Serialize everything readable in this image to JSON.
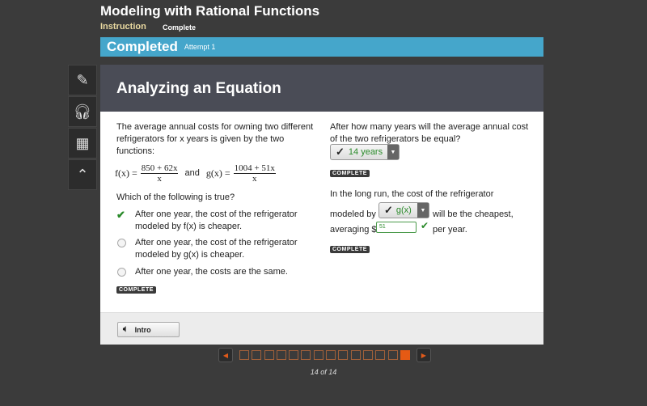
{
  "header": {
    "title": "Modeling with Rational Functions",
    "tabs": [
      "Instruction",
      "Complete"
    ]
  },
  "status": {
    "label": "Completed",
    "attempt": "Attempt 1",
    "color": "#45a6cb"
  },
  "tools": [
    "pencil-icon",
    "headphones-icon",
    "calculator-icon",
    "up-caret-icon"
  ],
  "section_title": "Analyzing an Equation",
  "left": {
    "intro": "The average annual costs for owning two different refrigerators for x years is given by the two functions:",
    "f_lhs": "f(x) =",
    "f_num": "850 + 62x",
    "f_den": "x",
    "and": "and",
    "g_lhs": "g(x) =",
    "g_num": "1004 + 51x",
    "g_den": "x",
    "question": "Which of the following is true?",
    "options": [
      {
        "text": "After one year, the cost of the refrigerator modeled by f(x) is cheaper.",
        "selected": true
      },
      {
        "text": "After one year, the cost of the refrigerator modeled by g(x) is cheaper.",
        "selected": false
      },
      {
        "text": "After one year, the costs are the same.",
        "selected": false
      }
    ],
    "badge": "COMPLETE"
  },
  "right": {
    "q1": "After how many years will the average annual cost of the two refrigerators be equal?",
    "q1_answer": "14 years",
    "badge": "COMPLETE",
    "q2_a": "In the long run, the cost of the refrigerator",
    "q2_b": "modeled by",
    "q2_select": "g(x)",
    "q2_c": "will be the cheapest,",
    "q2_d": "averaging $",
    "q2_input": "51",
    "q2_e": "per year.",
    "badge2": "COMPLETE"
  },
  "footer": {
    "intro_button": "Intro"
  },
  "pagination": {
    "current": 14,
    "total": 14,
    "label": "14 of 14"
  }
}
